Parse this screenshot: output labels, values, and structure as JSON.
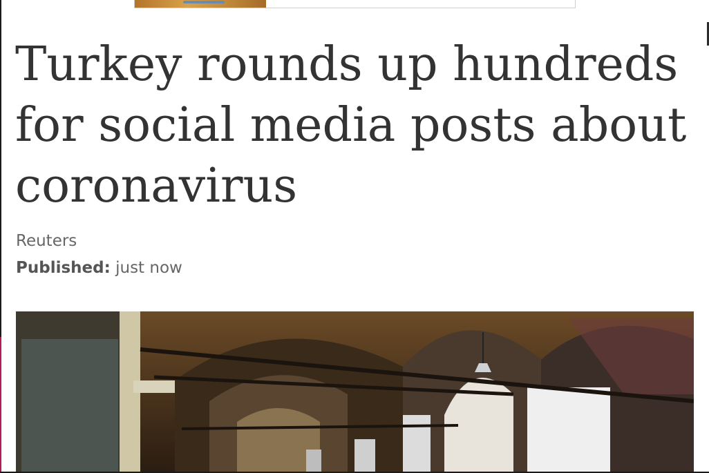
{
  "article": {
    "headline": "Turkey rounds up hundreds for social media posts about coronavirus",
    "source": "Reuters",
    "published_label": "Published:",
    "published_value": "just now"
  },
  "images": {
    "hero": "photo-icon",
    "ad": "ad-banner"
  },
  "colors": {
    "headline_text": "#333333",
    "meta_text": "#666666",
    "background": "#ffffff"
  }
}
